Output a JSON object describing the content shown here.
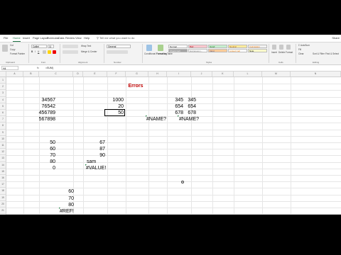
{
  "ribbon": {
    "tabs": [
      "File",
      "Home",
      "Insert",
      "Page Layout",
      "Formulas",
      "Data",
      "Review",
      "View",
      "Help"
    ],
    "active_tab": "Home",
    "tell_me": "Tell me what you want to do",
    "share": "Share",
    "clipboard": {
      "cut": "Cut",
      "copy": "Copy",
      "format_painter": "Format Painter",
      "label": "Clipboard"
    },
    "font": {
      "name": "Calibri",
      "size": "11",
      "label": "Font"
    },
    "alignment": {
      "wrap": "Wrap Text",
      "merge": "Merge & Center",
      "label": "Alignment"
    },
    "number": {
      "format": "General",
      "label": "Number"
    },
    "styles": {
      "conditional": "Conditional Formatting",
      "format_table": "Format as Table",
      "cells": [
        {
          "text": "Normal",
          "bg": "#ffffff",
          "fg": "#000000"
        },
        {
          "text": "Bad",
          "bg": "#ffc7ce",
          "fg": "#9c0006"
        },
        {
          "text": "Good",
          "bg": "#c6efce",
          "fg": "#006100"
        },
        {
          "text": "Neutral",
          "bg": "#ffeb9c",
          "fg": "#9c5700"
        },
        {
          "text": "Calculation",
          "bg": "#f2f2f2",
          "fg": "#fa7d00"
        },
        {
          "text": "Check Cell",
          "bg": "#a5a5a5",
          "fg": "#ffffff"
        },
        {
          "text": "Explanatory...",
          "bg": "#ffffff",
          "fg": "#7f7f7f"
        },
        {
          "text": "Input",
          "bg": "#ffcc99",
          "fg": "#3f3f76"
        },
        {
          "text": "Linked Cell",
          "bg": "#ffffff",
          "fg": "#fa7d00"
        },
        {
          "text": "Note",
          "bg": "#ffffcc",
          "fg": "#000000"
        }
      ],
      "label": "Styles"
    },
    "cells_group": {
      "insert": "Insert",
      "delete": "Delete",
      "format": "Format",
      "label": "Cells"
    },
    "editing": {
      "autosum": "AutoSum",
      "fill": "Fill",
      "clear": "Clear",
      "sort": "Sort & Filter",
      "find": "Find & Select",
      "label": "Editing"
    }
  },
  "formula_bar": {
    "name_box": "H4",
    "fx": "fx",
    "value": "=SUM("
  },
  "columns": [
    "A",
    "B",
    "C",
    "D",
    "E",
    "F",
    "G",
    "H",
    "I",
    "J",
    "K",
    "L",
    "M",
    "N",
    "O"
  ],
  "rows": [
    "1",
    "2",
    "3",
    "4",
    "5",
    "6",
    "7",
    "8",
    "9",
    "10",
    "11",
    "12",
    "13",
    "14",
    "15",
    "16",
    "17",
    "18",
    "19",
    "20",
    "21",
    "22",
    "23",
    "24",
    "25",
    "26"
  ],
  "title": "Errors",
  "cells": {
    "c_34567": "34567",
    "c_76542": "76542",
    "c_456789": "456789",
    "c_567898": "567898",
    "g_1000": "1000",
    "g_20": "20",
    "g_50": "50",
    "i_345": "345",
    "i_654": "654",
    "i_678": "678",
    "i_name": "#NAME?",
    "k_345": "345",
    "k_654": "654",
    "k_678": "678",
    "k_name": "#NAME?",
    "c_50": "50",
    "c_60": "60",
    "c_70": "70",
    "c_80": "80",
    "c_0": "0",
    "e_67": "67",
    "e_87": "87",
    "e_90": "90",
    "e_sam": "sam",
    "e_value": "#VALUE!",
    "d_60": "60",
    "d_70": "70",
    "d_80": "80",
    "d_ref": "#REF!"
  },
  "colors": {
    "excel_green": "#217346",
    "title_red": "#c00000"
  }
}
